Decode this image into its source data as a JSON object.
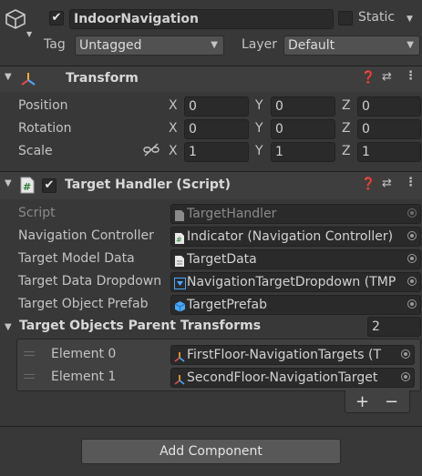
{
  "gameobject": {
    "name": "IndoorNavigation",
    "static_label": "Static",
    "tag_label": "Tag",
    "tag_value": "Untagged",
    "layer_label": "Layer",
    "layer_value": "Default",
    "active_check": "✔"
  },
  "transform": {
    "title": "Transform",
    "rows": [
      {
        "label": "Position",
        "x": "0",
        "y": "0",
        "z": "0"
      },
      {
        "label": "Rotation",
        "x": "0",
        "y": "0",
        "z": "0"
      },
      {
        "label": "Scale",
        "x": "1",
        "y": "1",
        "z": "1"
      }
    ],
    "axis_x": "X",
    "axis_y": "Y",
    "axis_z": "Z"
  },
  "script_component": {
    "title": "Target Handler (Script)",
    "enabled_check": "✔",
    "fields": [
      {
        "label": "Script",
        "value": "TargetHandler",
        "icon": "script-icon"
      },
      {
        "label": "Navigation Controller",
        "value": "Indicator (Navigation Controller)",
        "icon": "script-icon"
      },
      {
        "label": "Target Model Data",
        "value": "TargetData",
        "icon": "asset-icon"
      },
      {
        "label": "Target Data Dropdown",
        "value": "NavigationTargetDropdown (TMP",
        "icon": "dropdown-icon"
      },
      {
        "label": "Target Object Prefab",
        "value": "TargetPrefab",
        "icon": "prefab-icon"
      }
    ],
    "list": {
      "label": "Target Objects Parent Transforms",
      "count": "2",
      "elements": [
        {
          "label": "Element 0",
          "value": "FirstFloor-NavigationTargets (T"
        },
        {
          "label": "Element 1",
          "value": "SecondFloor-NavigationTarget"
        }
      ],
      "add": "+",
      "remove": "−"
    }
  },
  "add_component": "Add Component",
  "colors": {
    "background": "#383838",
    "field": "#2a2a2a",
    "header": "#3e3e3e",
    "accent_blue": "#4aa8ff"
  }
}
